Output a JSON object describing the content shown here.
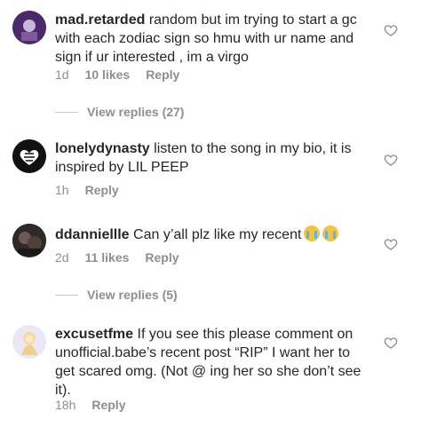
{
  "comments": [
    {
      "username": "mad.retarded",
      "text": " random but im trying to start a gc with each zodiac sign so hmu with ur name and sign if ur interested , im a virgo",
      "time": "1d",
      "likes": "10 likes",
      "reply": "Reply",
      "view_replies": "View replies (27)"
    },
    {
      "username": "lonelydynasty",
      "text": " listen to the song in my bio, it is inspired by LIL PEEP",
      "time": "1h",
      "reply": "Reply"
    },
    {
      "username": "ddanniellle",
      "text": " Can y’all plz like my recent",
      "time": "2d",
      "likes": "11 likes",
      "reply": "Reply",
      "view_replies": "View replies (5)"
    },
    {
      "username": "excusetfme",
      "text": " If you see this please comment on unofficial.babe’s recent post “RIP” I want her to get scared omg. (Not @ ing her so she don’t see it).",
      "time": "18h",
      "reply": "Reply"
    }
  ],
  "icons": {
    "heart": "heart-outline-icon",
    "emoji": "crying-face-emoji"
  },
  "colors": {
    "text": "#262626",
    "meta": "#8e8e8e",
    "avatar1": "#5a2d7a",
    "avatar2": "#111111",
    "avatar3": "#3a3030",
    "avatar4": "#e9e3f5"
  }
}
